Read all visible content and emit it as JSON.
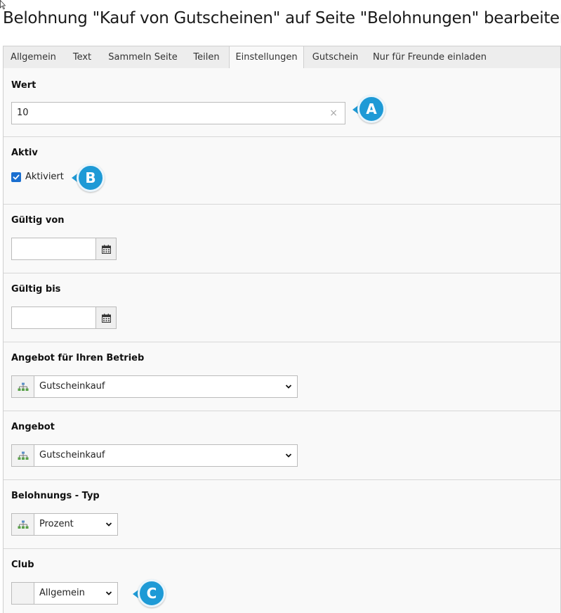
{
  "page": {
    "title": "Belohnung \"Kauf von Gutscheinen\" auf Seite \"Belohnungen\" bearbeiten"
  },
  "tabs": [
    {
      "label": "Allgemein"
    },
    {
      "label": "Text"
    },
    {
      "label": "Sammeln Seite"
    },
    {
      "label": "Teilen"
    },
    {
      "label": "Einstellungen",
      "active": true
    },
    {
      "label": "Gutschein"
    },
    {
      "label": "Nur für Freunde einladen"
    }
  ],
  "fields": {
    "wert": {
      "label": "Wert",
      "value": "10",
      "clear_glyph": "×"
    },
    "aktiv": {
      "label": "Aktiv",
      "checkbox_label": "Aktiviert",
      "checked": true
    },
    "gueltig_von": {
      "label": "Gültig von",
      "value": ""
    },
    "gueltig_bis": {
      "label": "Gültig bis",
      "value": ""
    },
    "angebot_betrieb": {
      "label": "Angebot für Ihren Betrieb",
      "value": "Gutscheinkauf"
    },
    "angebot": {
      "label": "Angebot",
      "value": "Gutscheinkauf"
    },
    "belohnungs_typ": {
      "label": "Belohnungs - Typ",
      "value": "Prozent"
    },
    "club": {
      "label": "Club",
      "value": "Allgemein"
    }
  },
  "callouts": {
    "a": "A",
    "b": "B",
    "c": "C"
  },
  "colors": {
    "accent": "#1e9ad6",
    "checkbox": "#1a6fd0",
    "panel_bg": "#f9f9f9",
    "tab_bar_bg": "#ededed"
  },
  "icons": {
    "calendar": "calendar-icon",
    "tree": "tree-icon",
    "chevron": "chevron-down-icon"
  }
}
